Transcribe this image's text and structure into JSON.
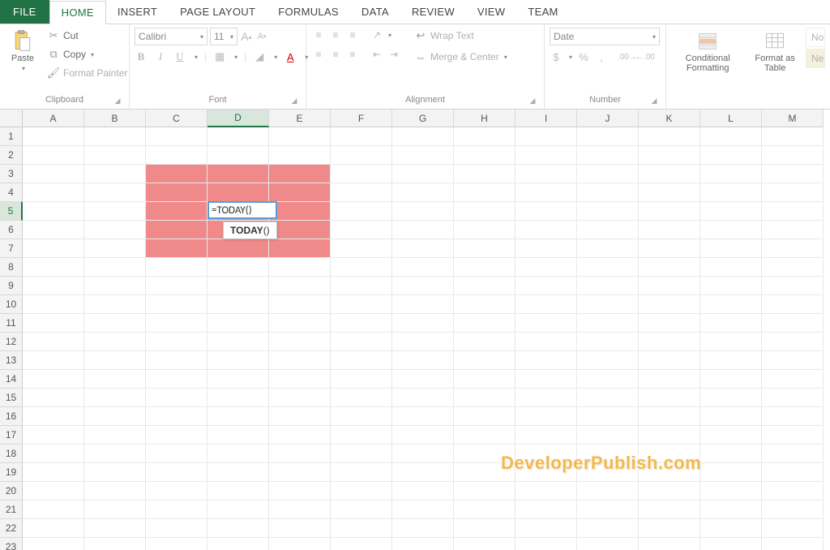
{
  "tabs": {
    "file": "FILE",
    "home": "HOME",
    "insert": "INSERT",
    "page_layout": "PAGE LAYOUT",
    "formulas": "FORMULAS",
    "data": "DATA",
    "review": "REVIEW",
    "view": "VIEW",
    "team": "TEAM"
  },
  "ribbon": {
    "clipboard": {
      "label": "Clipboard",
      "paste": "Paste",
      "cut": "Cut",
      "copy": "Copy",
      "format_painter": "Format Painter"
    },
    "font": {
      "label": "Font",
      "name": "Calibri",
      "size": "11"
    },
    "alignment": {
      "label": "Alignment",
      "wrap_text": "Wrap Text",
      "merge_center": "Merge & Center"
    },
    "number": {
      "label": "Number",
      "format": "Date"
    },
    "styles": {
      "conditional": "Conditional Formatting",
      "format_as_table": "Format as Table",
      "normal": "No",
      "neutral": "Ne"
    }
  },
  "grid": {
    "columns": [
      "A",
      "B",
      "C",
      "D",
      "E",
      "F",
      "G",
      "H",
      "I",
      "J",
      "K",
      "L",
      "M"
    ],
    "rows": [
      "1",
      "2",
      "3",
      "4",
      "5",
      "6",
      "7",
      "8",
      "9",
      "10",
      "11",
      "12",
      "13",
      "14",
      "15",
      "16",
      "17",
      "18",
      "19",
      "20",
      "21",
      "22",
      "23"
    ],
    "active_col": "D",
    "active_row": "5",
    "editing_value": "=TODAY()",
    "tooltip_fn": "TODAY",
    "tooltip_args": "()"
  },
  "watermark": "DeveloperPublish.com"
}
